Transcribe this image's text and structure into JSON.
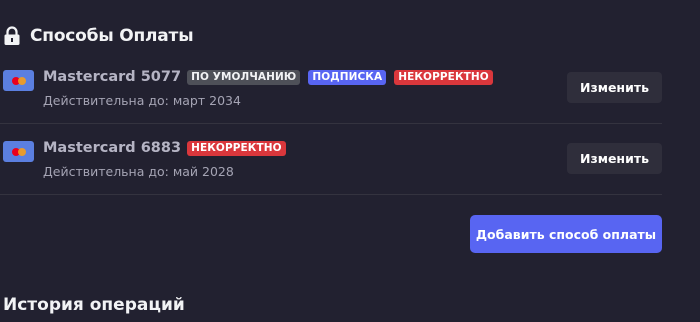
{
  "payment": {
    "title": "Способы Оплаты",
    "cards": [
      {
        "name": "Mastercard 5077",
        "badges": [
          "ПО УМОЛЧАНИЮ",
          "ПОДПИСКА",
          "НЕКОРРЕКТНО"
        ],
        "expiry": "Действительна до: март 2034",
        "edit_label": "Изменить"
      },
      {
        "name": "Mastercard 6883",
        "badges": [
          "НЕКОРРЕКТНО"
        ],
        "expiry": "Действительна до: май 2028",
        "edit_label": "Изменить"
      }
    ],
    "add_label": "Добавить способ оплаты"
  },
  "history": {
    "title": "История операций"
  },
  "colors": {
    "background": "#222130",
    "accent": "#5865f2",
    "badge_default": "#4e5058",
    "badge_error": "#da373c",
    "card_brand": "#5b7fe0"
  },
  "icons": {
    "section": "lock-icon",
    "card": "mastercard-icon"
  }
}
